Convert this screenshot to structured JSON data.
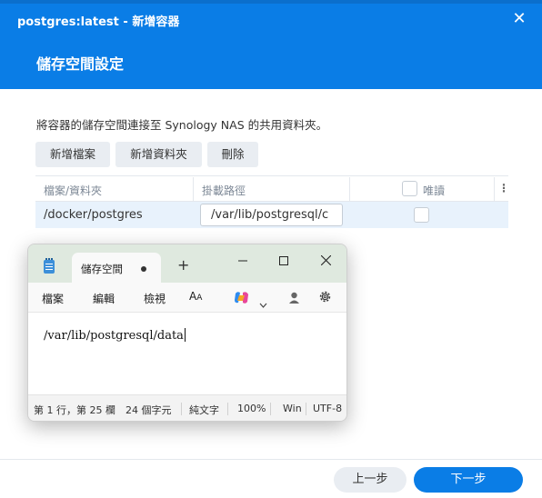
{
  "wizard": {
    "title": "postgres:latest - 新增容器",
    "step_title": "儲存空間設定",
    "description": "將容器的儲存空間連接至 Synology NAS 的共用資料夾。",
    "toolbar": {
      "add_file": "新增檔案",
      "add_folder": "新增資料夾",
      "delete": "刪除"
    },
    "grid": {
      "columns": [
        "檔案/資料夾",
        "掛載路徑",
        "唯讀"
      ],
      "rows": [
        {
          "file_folder": "/docker/postgres",
          "mount_path": "/var/lib/postgresql/c",
          "read_only": false
        }
      ]
    },
    "footer": {
      "prev": "上一步",
      "next": "下一步"
    },
    "colors": {
      "header": "#0a7de6",
      "primary_button": "#0a7de6",
      "selected_row": "#e8f2fc"
    }
  },
  "notepad": {
    "tab_title": "儲存空間",
    "menus": [
      "檔案",
      "編輯",
      "檢視"
    ],
    "content": "/var/lib/postgresql/data",
    "status": {
      "position": "第 1 行，第 25 欄",
      "chars": "24 個字元",
      "format": "純文字",
      "zoom": "100%",
      "line_ending": "Win",
      "encoding": "UTF-8"
    },
    "icons": [
      "notepad-app-icon",
      "tab-modified-dot-icon",
      "new-tab-plus-icon",
      "minimize-icon",
      "maximize-icon",
      "close-icon",
      "text-size-icon",
      "copilot-icon",
      "chevron-down-icon",
      "profile-icon",
      "settings-gear-icon"
    ]
  }
}
